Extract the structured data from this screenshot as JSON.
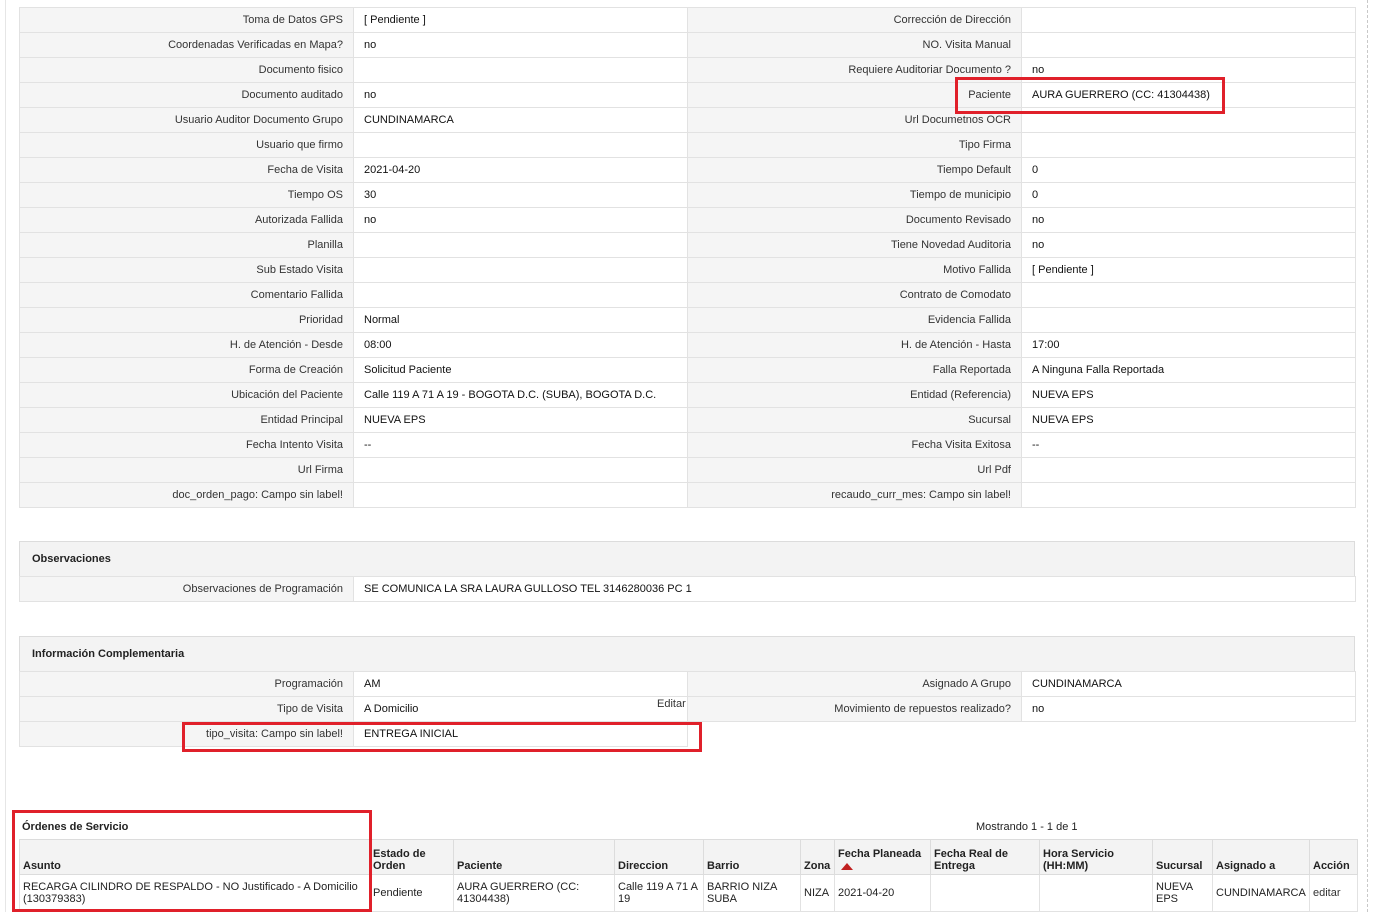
{
  "detail_rows": [
    {
      "l1": "Toma de Datos GPS",
      "v1": "[ Pendiente ]",
      "l2": "Corrección de Dirección",
      "v2": ""
    },
    {
      "l1": "Coordenadas Verificadas en Mapa?",
      "v1": " no",
      "l2": "NO. Visita Manual",
      "v2": ""
    },
    {
      "l1": "Documento fisico",
      "v1": "",
      "l2": "Requiere Auditoriar Documento ?",
      "v2": " no"
    },
    {
      "l1": "Documento auditado",
      "v1": " no",
      "l2": "Paciente",
      "v2": "AURA GUERRERO (CC: 41304438)"
    },
    {
      "l1": "Usuario Auditor Documento Grupo",
      "v1": "CUNDINAMARCA",
      "l2": "Url Documetnos OCR",
      "v2": ""
    },
    {
      "l1": "Usuario que firmo",
      "v1": "",
      "l2": "Tipo Firma",
      "v2": ""
    },
    {
      "l1": "Fecha de Visita",
      "v1": " 2021-04-20",
      "l2": "Tiempo Default",
      "v2": "0"
    },
    {
      "l1": "Tiempo OS",
      "v1": "30",
      "l2": "Tiempo de municipio",
      "v2": "0"
    },
    {
      "l1": "Autorizada Fallida",
      "v1": " no",
      "l2": "Documento Revisado",
      "v2": " no"
    },
    {
      "l1": "Planilla",
      "v1": "",
      "l2": "Tiene Novedad Auditoria",
      "v2": " no"
    },
    {
      "l1": "Sub Estado Visita",
      "v1": "",
      "l2": "Motivo Fallida",
      "v2": "[ Pendiente ]"
    },
    {
      "l1": "Comentario Fallida",
      "v1": "",
      "l2": "Contrato de Comodato",
      "v2": ""
    },
    {
      "l1": "Prioridad",
      "v1": "Normal",
      "l2": "Evidencia Fallida",
      "v2": ""
    },
    {
      "l1": "H. de Atención - Desde",
      "v1": "08:00",
      "l2": "H. de Atención - Hasta",
      "v2": "17:00"
    },
    {
      "l1": "Forma de Creación",
      "v1": "Solicitud Paciente",
      "l2": "Falla Reportada",
      "v2": "A Ninguna Falla Reportada"
    },
    {
      "l1": "Ubicación del Paciente",
      "v1": "Calle 119 A 71 A 19 - BOGOTA D.C. (SUBA), BOGOTA D.C.",
      "l2": "Entidad (Referencia)",
      "v2": "NUEVA EPS"
    },
    {
      "l1": "Entidad Principal",
      "v1": "NUEVA EPS",
      "l2": "Sucursal",
      "v2": "NUEVA EPS"
    },
    {
      "l1": "Fecha Intento Visita",
      "v1": " --",
      "l2": "Fecha Visita Exitosa",
      "v2": " --"
    },
    {
      "l1": "Url Firma",
      "v1": "",
      "l2": "Url Pdf",
      "v2": ""
    },
    {
      "l1": "doc_orden_pago: Campo sin label!",
      "v1": "",
      "l2": "recaudo_curr_mes: Campo sin label!",
      "v2": ""
    }
  ],
  "observaciones": {
    "title": "Observaciones",
    "label": "Observaciones de Programación",
    "value": " SE COMUNICA LA SRA LAURA GULLOSO TEL 3146280036 PC 1"
  },
  "info_comp": {
    "title": "Información Complementaria",
    "edit_label": "Editar",
    "rows": [
      {
        "l1": "Programación",
        "v1": "AM",
        "l2": "Asignado A Grupo",
        "v2": "CUNDINAMARCA"
      },
      {
        "l1": "Tipo de Visita",
        "v1": "A Domicilio",
        "l2": "Movimiento de repuestos realizado?",
        "v2": " no"
      },
      {
        "l1": "tipo_visita: Campo sin label!",
        "v1": "ENTREGA INICIAL"
      }
    ]
  },
  "orders": {
    "title": "Órdenes de Servicio",
    "count_text": "Mostrando 1 - 1 de 1",
    "columns": [
      "Asunto",
      "Estado de Orden",
      "Paciente",
      "Direccion",
      "Barrio",
      "Zona",
      "Fecha Planeada",
      "Fecha Real de Entrega",
      "Hora Servicio (HH:MM)",
      "Sucursal",
      "Asignado a",
      "Acción"
    ],
    "row": {
      "asunto": "RECARGA CILINDRO DE RESPALDO - NO Justificado - A Domicilio (130379383)",
      "estado": "Pendiente",
      "paciente": "AURA GUERRERO (CC: 41304438)",
      "direccion": "Calle 119 A 71 A 19",
      "barrio": "BARRIO NIZA SUBA",
      "zona": "NIZA",
      "fecha_planeada": "2021-04-20",
      "fecha_real": "",
      "hora": "",
      "sucursal": "NUEVA EPS",
      "asignado": "CUNDINAMARCA",
      "accion": "editar"
    }
  },
  "colors": {
    "highlight": "#e0202a",
    "label_bg": "#f5f5f5",
    "header_bg": "#f3f3f3"
  }
}
